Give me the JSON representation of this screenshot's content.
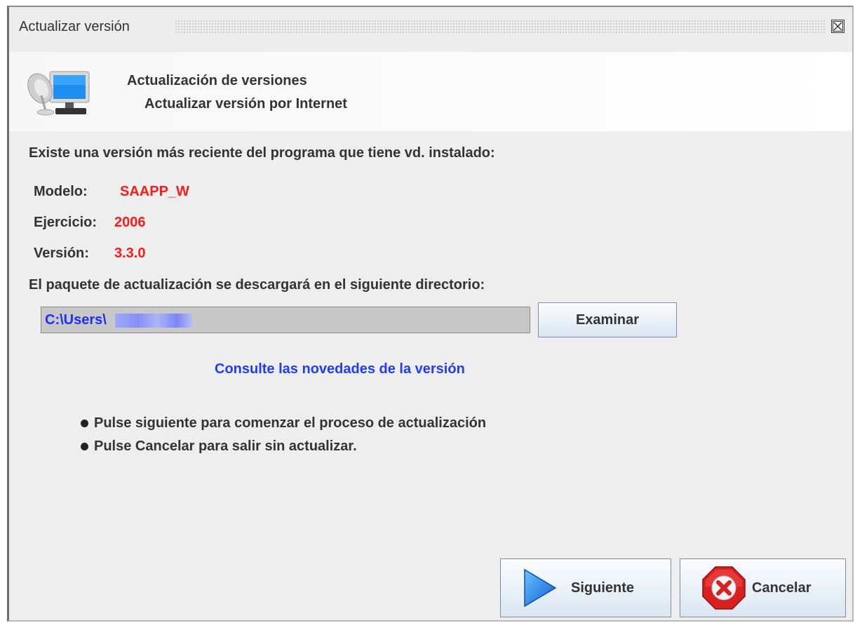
{
  "window": {
    "title": "Actualizar versión",
    "close_icon": "close-icon"
  },
  "header": {
    "title": "Actualización de versiones",
    "subtitle": "Actualizar versión por Internet",
    "icon": "monitor-satellite-icon"
  },
  "intro_text": "Existe una versión más reciente del programa que tiene vd. instalado:",
  "info": {
    "modelo_label": "Modelo:",
    "modelo_value": "SAAPP_W",
    "ejercicio_label": "Ejercicio:",
    "ejercicio_value": "2006",
    "version_label": "Versión:",
    "version_value": "3.3.0"
  },
  "directory_text": "El paquete de actualización se descargará en el siguiente directorio:",
  "path_field": {
    "value": "C:\\Users\\"
  },
  "browse_button": "Examinar",
  "release_notes_link": "Consulte las novedades de la versión",
  "instructions": [
    "Pulse siguiente para comenzar el proceso de actualización",
    "Pulse Cancelar para salir sin actualizar."
  ],
  "buttons": {
    "next": "Siguiente",
    "cancel": "Cancelar"
  },
  "colors": {
    "value_red": "#ff1a1a",
    "link_blue": "#1f3bff",
    "path_text": "#1c2eff"
  }
}
